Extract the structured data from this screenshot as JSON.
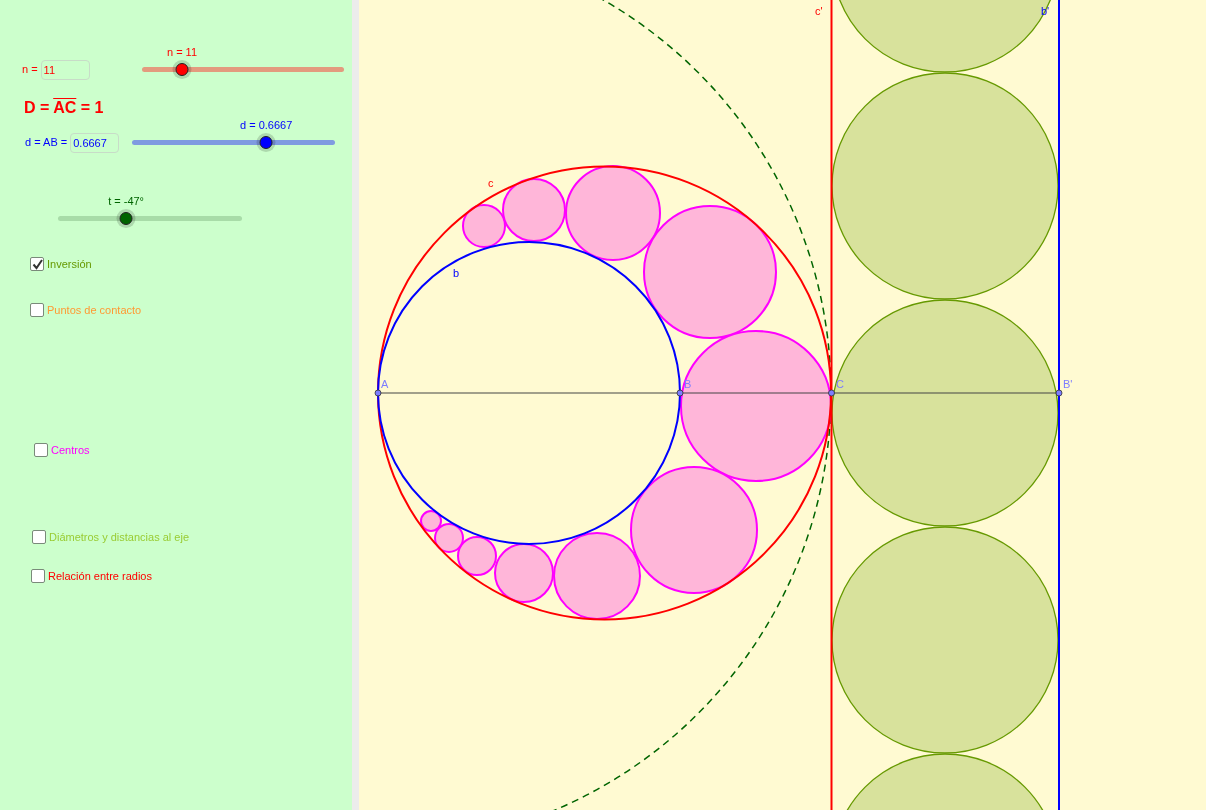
{
  "inputs": [
    {
      "label": "n =",
      "value": "11",
      "color": "#ff0000"
    },
    {
      "label": "d = AB =",
      "value": "0.6667",
      "color": "#0000ff"
    }
  ],
  "formula": {
    "lhs": "D =",
    "overlined": "AC",
    "rhs": "= 1"
  },
  "sliders": [
    {
      "label": "n = 11",
      "level": 0.2,
      "color": "#ff0000"
    },
    {
      "label": "d = 0.6667",
      "level": 0.66,
      "color": "#0000ff"
    },
    {
      "label": "t = -47°",
      "level": 0.37,
      "color": "#006400"
    }
  ],
  "checkboxes": [
    {
      "label": "Inversión",
      "checked": true,
      "color": "#669900"
    },
    {
      "label": "Puntos de contacto",
      "checked": false,
      "color": "#ff9933"
    },
    {
      "label": "Centros",
      "checked": false,
      "color": "#ff00ff"
    },
    {
      "label": "Diámetros y distancias al eje",
      "checked": false,
      "color": "#99cc33"
    },
    {
      "label": "Relación entre radios",
      "checked": false,
      "color": "#ff0000"
    }
  ],
  "canvas_labels": [
    "c",
    "b",
    "A",
    "B",
    "C",
    "B'",
    "c'",
    "b'"
  ]
}
